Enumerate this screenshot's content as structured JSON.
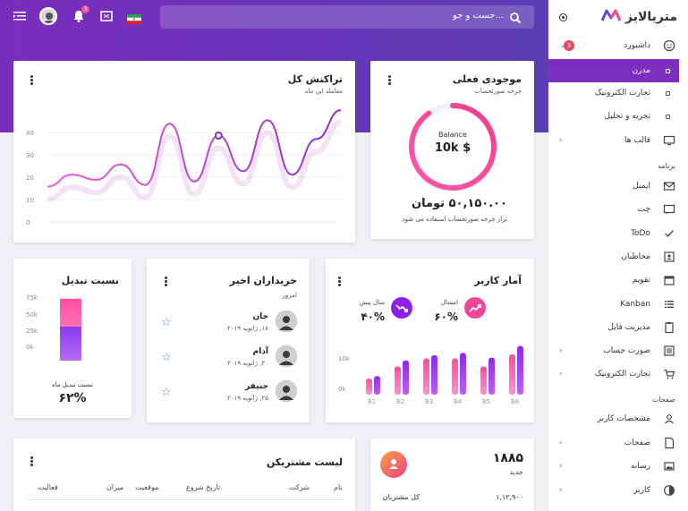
{
  "topbar": {
    "search_placeholder": "جست و جو...",
    "notification_count": "3",
    "icons": [
      "menu-icon",
      "avatar",
      "bell-icon",
      "fullscreen-icon",
      "flag-icon",
      "search-icon"
    ]
  },
  "sidebar": {
    "brand": "متریالایز",
    "dashboard": {
      "label": "داشبورد",
      "badge": "3"
    },
    "sub_items": [
      {
        "label": "مدرن",
        "active": true
      },
      {
        "label": "تجارت الکترونیک"
      },
      {
        "label": "تجزیه و تحلیل"
      }
    ],
    "templates": {
      "label": "قالب ها"
    },
    "section_app": "برنامه",
    "app_items": [
      {
        "label": "ایمیل",
        "icon": "mail-icon"
      },
      {
        "label": "چت",
        "icon": "chat-icon"
      },
      {
        "label": "ToDo",
        "icon": "check-icon"
      },
      {
        "label": "مخاطبان",
        "icon": "contacts-icon"
      },
      {
        "label": "تقویم",
        "icon": "calendar-icon"
      },
      {
        "label": "Kanban",
        "icon": "kanban-icon"
      },
      {
        "label": "مدیریت فایل",
        "icon": "file-icon"
      },
      {
        "label": "صورت حساب",
        "icon": "invoice-icon"
      },
      {
        "label": "تجارت الکترونیک",
        "icon": "cart-icon"
      }
    ],
    "section_pages": "صفحات",
    "page_items": [
      {
        "label": "مشخصات کاربر",
        "icon": "user-icon"
      },
      {
        "label": "صفحات",
        "icon": "page-icon"
      },
      {
        "label": "رسانه",
        "icon": "media-icon"
      },
      {
        "label": "کاربر",
        "icon": "user-circle-icon"
      }
    ]
  },
  "balance_card": {
    "title": "موجودی فعلی",
    "subtitle": "چرخه صورتحساب",
    "ring_label": "Balance",
    "ring_value": "10k $",
    "amount": "۵۰,۱۵۰.۰۰ تومان",
    "note": "تراز چرخه صورتحساب استفاده می شود",
    "ring_fraction": 0.9
  },
  "transactions_card": {
    "title": "تراکنش کل",
    "subtitle": "معامله این ماه",
    "y_ticks": [
      "40",
      "30",
      "20",
      "10",
      "0"
    ]
  },
  "user_stats": {
    "title": "آمار کاربر",
    "this_year_label": "امسال",
    "this_year_value": "۶۰%",
    "last_year_label": "سال پیش",
    "last_year_value": "۴۰%",
    "y_ticks": [
      "10k",
      "0k"
    ]
  },
  "buyers": {
    "title": "خریداران اخیر",
    "subtitle": "امروز",
    "items": [
      {
        "name": "جان",
        "date": "۱۸, ژانویه ۲۰۱۹"
      },
      {
        "name": "آدام",
        "date": "۲۰, ژانویه ۲۰۱۹"
      },
      {
        "name": "جنیفر",
        "date": "۲۵, ژانویه ۲۰۱۹"
      }
    ]
  },
  "conversion": {
    "title": "نسبت تبدیل",
    "y_ticks": [
      "75k",
      "50k",
      "25k",
      "0k"
    ],
    "label": "نسبت تبدیل ماه",
    "value": "۶۲%"
  },
  "customers": {
    "title": "لیست مشتریکن",
    "headers": [
      "نام",
      "شرکت",
      "تاریخ شروع",
      "موقعیت",
      "میزان",
      "فعالیت"
    ]
  },
  "new_card": {
    "value": "۱۸۸۵",
    "label": "جدید",
    "total_label": "کل مشتریان",
    "total_value": "۱,۱۲,۹۰۰"
  },
  "chart_data": [
    {
      "type": "line",
      "title": "تراکنش کل",
      "ylim": [
        0,
        50
      ],
      "y_ticks": [
        0,
        10,
        20,
        30,
        40
      ],
      "x": [
        0,
        1,
        2,
        3,
        4,
        5,
        6,
        7,
        8,
        9,
        10,
        11,
        12
      ],
      "series": [
        {
          "values": [
            5,
            12,
            9,
            18,
            6,
            42,
            8,
            35,
            14,
            44,
            12,
            33,
            50
          ]
        }
      ]
    },
    {
      "type": "bar",
      "title": "آمار کاربر",
      "categories": [
        "B1",
        "B2",
        "B3",
        "B4",
        "B5",
        "B6"
      ],
      "ylim": [
        0,
        16
      ],
      "series": [
        {
          "name": "سال پیش",
          "values": [
            4,
            7,
            9,
            9,
            7,
            10
          ]
        },
        {
          "name": "امسال",
          "values": [
            4.6,
            8.5,
            9.8,
            10.4,
            9.2,
            12.1
          ]
        }
      ]
    },
    {
      "type": "bar",
      "title": "نسبت تبدیل",
      "categories": [
        "month"
      ],
      "ylim": [
        0,
        75
      ],
      "series": [
        {
          "values": [
            72
          ]
        }
      ]
    }
  ]
}
